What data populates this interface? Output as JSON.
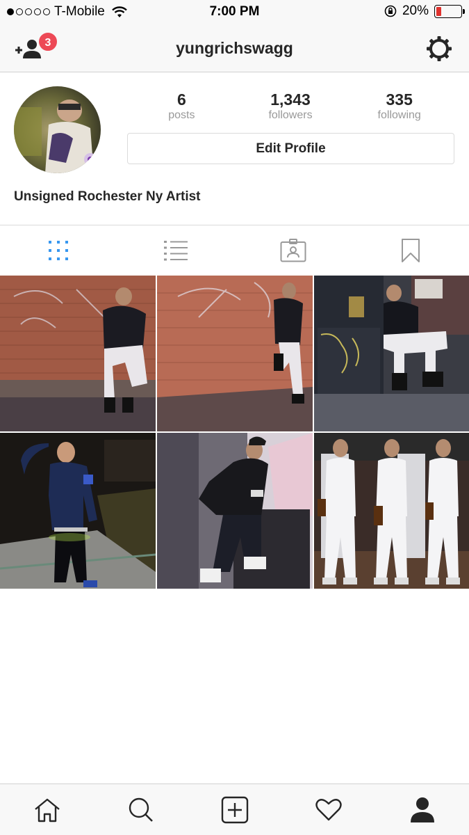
{
  "status_bar": {
    "carrier": "T-Mobile",
    "time": "7:00 PM",
    "battery_percent": "20%",
    "battery_level": 0.2,
    "signal_bars_filled": 1,
    "signal_bars_total": 5
  },
  "nav": {
    "username": "yungrichswagg",
    "notification_count": "3"
  },
  "profile": {
    "posts_count": "6",
    "posts_label": "posts",
    "followers_count": "1,343",
    "followers_label": "followers",
    "following_count": "335",
    "following_label": "following",
    "edit_profile_label": "Edit Profile",
    "bio": "Unsigned Rochester Ny Artist"
  },
  "tabs": [
    {
      "name": "grid-view",
      "icon": "grid-icon",
      "active": true
    },
    {
      "name": "list-view",
      "icon": "list-icon",
      "active": false
    },
    {
      "name": "tagged",
      "icon": "tagged-photo-icon",
      "active": false
    },
    {
      "name": "saved",
      "icon": "bookmark-icon",
      "active": false
    }
  ],
  "posts": [
    {
      "scene": "man crouching against brick wall with graffiti"
    },
    {
      "scene": "man leaning against brick wall at night"
    },
    {
      "scene": "man sitting on dumpster in alley"
    },
    {
      "scene": "man posing on sidewalk at night"
    },
    {
      "scene": "man in leather jacket looking at phone"
    },
    {
      "scene": "collage of man in white outfit holding bottle"
    }
  ],
  "bottom_tabs": [
    {
      "name": "home",
      "icon": "home-icon"
    },
    {
      "name": "search",
      "icon": "search-icon"
    },
    {
      "name": "new-post",
      "icon": "plus-square-icon"
    },
    {
      "name": "activity",
      "icon": "heart-icon"
    },
    {
      "name": "profile",
      "icon": "person-icon",
      "active": true
    }
  ],
  "colors": {
    "accent_blue": "#3897f0",
    "badge_red": "#ed4956",
    "battery_red": "#e0332f",
    "text_dark": "#262626",
    "text_muted": "#999999",
    "border": "#dbdbdb"
  }
}
